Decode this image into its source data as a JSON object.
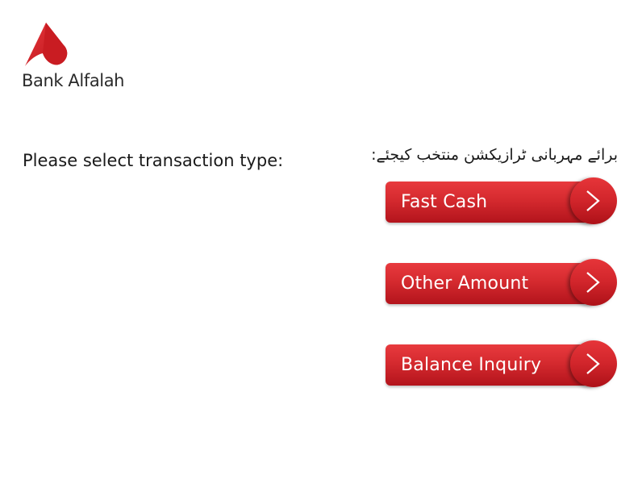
{
  "brand": {
    "name": "Bank Alfalah",
    "color": "#e0262b"
  },
  "prompt": {
    "english": "Please select transaction type:",
    "urdu": "برائے مہربانی ٹرازیکشن منتخب کیجئے:"
  },
  "menu": {
    "items": [
      {
        "label": "Fast Cash",
        "icon": "chevron-right-icon"
      },
      {
        "label": "Other Amount",
        "icon": "chevron-right-icon"
      },
      {
        "label": "Balance Inquiry",
        "icon": "chevron-right-icon"
      }
    ]
  }
}
